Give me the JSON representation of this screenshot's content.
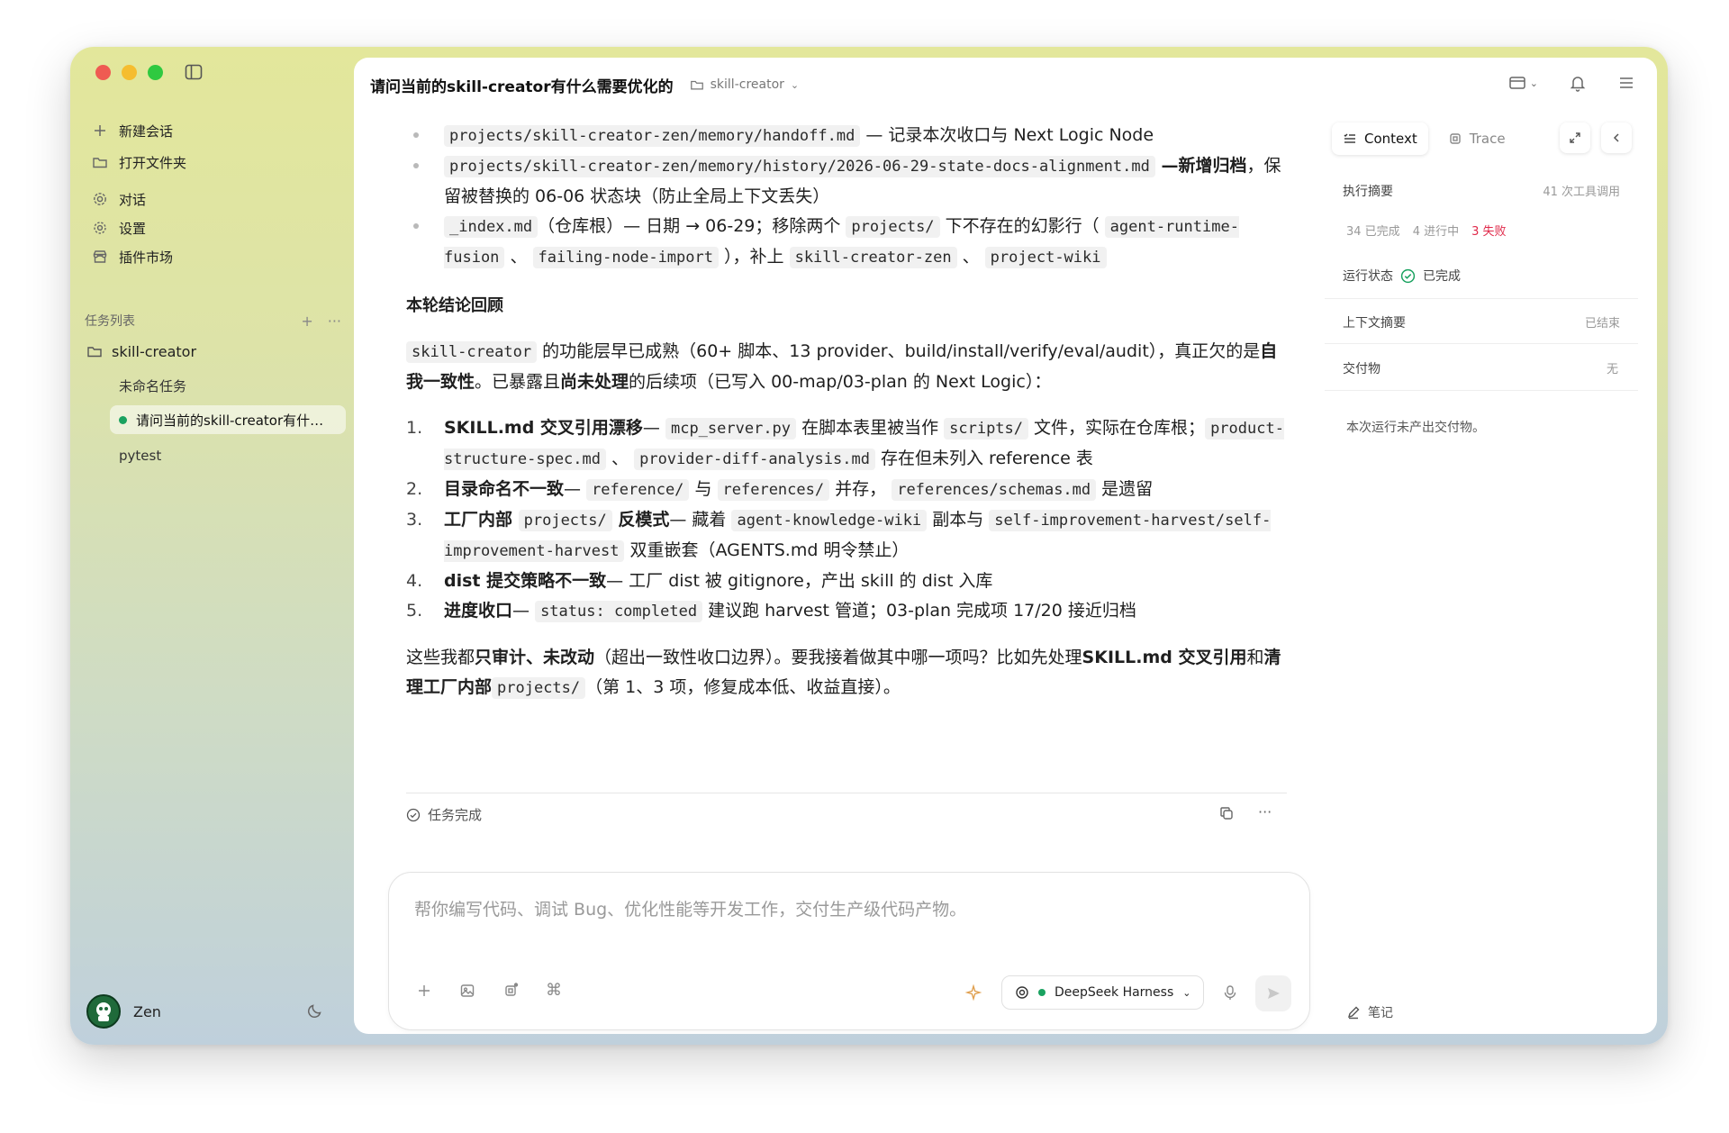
{
  "sidebar": {
    "new_chat": "新建会话",
    "open_folder": "打开文件夹",
    "nav": [
      {
        "label": "对话",
        "icon": "gear-icon"
      },
      {
        "label": "设置",
        "icon": "settings-icon"
      },
      {
        "label": "插件市场",
        "icon": "store-icon"
      }
    ],
    "section_title": "任务列表",
    "folder": "skill-creator",
    "tasks": [
      "未命名任务",
      "请问当前的skill-creator有什么需要优化的",
      "pytest"
    ],
    "user": "Zen"
  },
  "header": {
    "title": "请问当前的skill-creator有什么需要优化的",
    "folder": "skill-creator"
  },
  "message": {
    "bullets": [
      {
        "code": "projects/skill-creator-zen/memory/handoff.md",
        "text": " — 记录本次收口与 Next Logic Node"
      },
      {
        "code": "projects/skill-creator-zen/memory/history/2026-06-29-state-docs-alignment.md",
        "bold": " —新增归档",
        "text": "，保留被替换的 06-06 状态块（防止全局上下文丢失）"
      },
      {
        "code": "_index.md",
        "t1": "（仓库根）— 日期 → 06-29；移除两个 ",
        "c2": "projects/",
        "t2": " 下不存在的幻影行（ ",
        "c3": "agent-runtime-fusion",
        "t3": " 、 ",
        "c4": "failing-node-import",
        "t4": " ），补上 ",
        "c5": "skill-creator-zen",
        "t5": " 、 ",
        "c6": "project-wiki"
      }
    ],
    "heading": "本轮结论回顾",
    "para1": {
      "code": "skill-creator",
      "t1": " 的功能层早已成熟（60+ 脚本、13 provider、build/install/verify/eval/audit），真正欠的是",
      "b1": "自我一致性",
      "t2": "。已暴露且",
      "b2": "尚未处理",
      "t3": "的后续项（已写入 00-map/03-plan 的 Next Logic）："
    },
    "items": [
      {
        "num": "1.",
        "b": "SKILL.md 交叉引用漂移",
        "t1": "— ",
        "c1": "mcp_server.py",
        "t2": " 在脚本表里被当作 ",
        "c2": "scripts/",
        "t3": " 文件，实际在仓库根；",
        "c3": "product-structure-spec.md",
        "t4": " 、 ",
        "c4": "provider-diff-analysis.md",
        "t5": " 存在但未列入 reference 表"
      },
      {
        "num": "2.",
        "b": "目录命名不一致",
        "t1": "— ",
        "c1": "reference/",
        "t2": " 与 ",
        "c2": "references/",
        "t3": " 并存， ",
        "c3": "references/schemas.md",
        "t4": " 是遗留"
      },
      {
        "num": "3.",
        "b": "工厂内部 ",
        "c1": "projects/",
        "b2": " 反模式",
        "t1": "— 藏着 ",
        "c2": "agent-knowledge-wiki",
        "t2": " 副本与 ",
        "c3": "self-improvement-harvest/self-improvement-harvest",
        "t3": " 双重嵌套（AGENTS.md 明令禁止）"
      },
      {
        "num": "4.",
        "b": "dist 提交策略不一致",
        "t1": "— 工厂 dist 被 gitignore，产出 skill 的 dist 入库"
      },
      {
        "num": "5.",
        "b": "进度收口",
        "t1": "— ",
        "c1": "status: completed",
        "t2": " 建议跑 harvest 管道；03-plan 完成项 17/20 接近归档"
      }
    ],
    "para2": {
      "t1": "这些我都",
      "b1": "只审计、未改动",
      "t2": "（超出一致性收口边界）。要我接着做其中哪一项吗？比如先处理",
      "b2": "SKILL.md 交叉引用",
      "t3": "和",
      "b3": "清理工厂内部",
      "c1": "projects/",
      "t4": "（第 1、3 项，修复成本低、收益直接）。"
    },
    "status": "任务完成"
  },
  "composer": {
    "placeholder": "帮你编写代码、调试 Bug、优化性能等开发工作，交付生产级代码产物。",
    "model": "DeepSeek Harness"
  },
  "right_panel": {
    "tab_context": "Context",
    "tab_trace": "Trace",
    "exec_summary": "执行摘要",
    "tool_calls": "41 次工具调用",
    "done_count": "34 已完成",
    "running_count": "4 进行中",
    "fail_count": "3 失败",
    "run_state_label": "运行状态",
    "run_state": "已完成",
    "ctx_summary": "上下文摘要",
    "ctx_state": "已结束",
    "deliverables": "交付物",
    "deliverables_value": "无",
    "no_deliverables": "本次运行未产出交付物。",
    "note": "笔记"
  },
  "colors": {
    "accent_green": "#1aa260",
    "fail_red": "#e0294a"
  }
}
